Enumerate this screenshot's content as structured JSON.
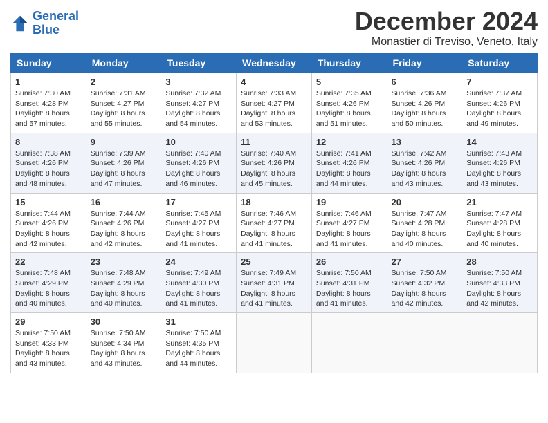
{
  "header": {
    "logo_line1": "General",
    "logo_line2": "Blue",
    "month": "December 2024",
    "location": "Monastier di Treviso, Veneto, Italy"
  },
  "weekdays": [
    "Sunday",
    "Monday",
    "Tuesday",
    "Wednesday",
    "Thursday",
    "Friday",
    "Saturday"
  ],
  "weeks": [
    [
      {
        "day": "1",
        "info": "Sunrise: 7:30 AM\nSunset: 4:28 PM\nDaylight: 8 hours\nand 57 minutes."
      },
      {
        "day": "2",
        "info": "Sunrise: 7:31 AM\nSunset: 4:27 PM\nDaylight: 8 hours\nand 55 minutes."
      },
      {
        "day": "3",
        "info": "Sunrise: 7:32 AM\nSunset: 4:27 PM\nDaylight: 8 hours\nand 54 minutes."
      },
      {
        "day": "4",
        "info": "Sunrise: 7:33 AM\nSunset: 4:27 PM\nDaylight: 8 hours\nand 53 minutes."
      },
      {
        "day": "5",
        "info": "Sunrise: 7:35 AM\nSunset: 4:26 PM\nDaylight: 8 hours\nand 51 minutes."
      },
      {
        "day": "6",
        "info": "Sunrise: 7:36 AM\nSunset: 4:26 PM\nDaylight: 8 hours\nand 50 minutes."
      },
      {
        "day": "7",
        "info": "Sunrise: 7:37 AM\nSunset: 4:26 PM\nDaylight: 8 hours\nand 49 minutes."
      }
    ],
    [
      {
        "day": "8",
        "info": "Sunrise: 7:38 AM\nSunset: 4:26 PM\nDaylight: 8 hours\nand 48 minutes."
      },
      {
        "day": "9",
        "info": "Sunrise: 7:39 AM\nSunset: 4:26 PM\nDaylight: 8 hours\nand 47 minutes."
      },
      {
        "day": "10",
        "info": "Sunrise: 7:40 AM\nSunset: 4:26 PM\nDaylight: 8 hours\nand 46 minutes."
      },
      {
        "day": "11",
        "info": "Sunrise: 7:40 AM\nSunset: 4:26 PM\nDaylight: 8 hours\nand 45 minutes."
      },
      {
        "day": "12",
        "info": "Sunrise: 7:41 AM\nSunset: 4:26 PM\nDaylight: 8 hours\nand 44 minutes."
      },
      {
        "day": "13",
        "info": "Sunrise: 7:42 AM\nSunset: 4:26 PM\nDaylight: 8 hours\nand 43 minutes."
      },
      {
        "day": "14",
        "info": "Sunrise: 7:43 AM\nSunset: 4:26 PM\nDaylight: 8 hours\nand 43 minutes."
      }
    ],
    [
      {
        "day": "15",
        "info": "Sunrise: 7:44 AM\nSunset: 4:26 PM\nDaylight: 8 hours\nand 42 minutes."
      },
      {
        "day": "16",
        "info": "Sunrise: 7:44 AM\nSunset: 4:26 PM\nDaylight: 8 hours\nand 42 minutes."
      },
      {
        "day": "17",
        "info": "Sunrise: 7:45 AM\nSunset: 4:27 PM\nDaylight: 8 hours\nand 41 minutes."
      },
      {
        "day": "18",
        "info": "Sunrise: 7:46 AM\nSunset: 4:27 PM\nDaylight: 8 hours\nand 41 minutes."
      },
      {
        "day": "19",
        "info": "Sunrise: 7:46 AM\nSunset: 4:27 PM\nDaylight: 8 hours\nand 41 minutes."
      },
      {
        "day": "20",
        "info": "Sunrise: 7:47 AM\nSunset: 4:28 PM\nDaylight: 8 hours\nand 40 minutes."
      },
      {
        "day": "21",
        "info": "Sunrise: 7:47 AM\nSunset: 4:28 PM\nDaylight: 8 hours\nand 40 minutes."
      }
    ],
    [
      {
        "day": "22",
        "info": "Sunrise: 7:48 AM\nSunset: 4:29 PM\nDaylight: 8 hours\nand 40 minutes."
      },
      {
        "day": "23",
        "info": "Sunrise: 7:48 AM\nSunset: 4:29 PM\nDaylight: 8 hours\nand 40 minutes."
      },
      {
        "day": "24",
        "info": "Sunrise: 7:49 AM\nSunset: 4:30 PM\nDaylight: 8 hours\nand 41 minutes."
      },
      {
        "day": "25",
        "info": "Sunrise: 7:49 AM\nSunset: 4:31 PM\nDaylight: 8 hours\nand 41 minutes."
      },
      {
        "day": "26",
        "info": "Sunrise: 7:50 AM\nSunset: 4:31 PM\nDaylight: 8 hours\nand 41 minutes."
      },
      {
        "day": "27",
        "info": "Sunrise: 7:50 AM\nSunset: 4:32 PM\nDaylight: 8 hours\nand 42 minutes."
      },
      {
        "day": "28",
        "info": "Sunrise: 7:50 AM\nSunset: 4:33 PM\nDaylight: 8 hours\nand 42 minutes."
      }
    ],
    [
      {
        "day": "29",
        "info": "Sunrise: 7:50 AM\nSunset: 4:33 PM\nDaylight: 8 hours\nand 43 minutes."
      },
      {
        "day": "30",
        "info": "Sunrise: 7:50 AM\nSunset: 4:34 PM\nDaylight: 8 hours\nand 43 minutes."
      },
      {
        "day": "31",
        "info": "Sunrise: 7:50 AM\nSunset: 4:35 PM\nDaylight: 8 hours\nand 44 minutes."
      },
      {
        "day": "",
        "info": ""
      },
      {
        "day": "",
        "info": ""
      },
      {
        "day": "",
        "info": ""
      },
      {
        "day": "",
        "info": ""
      }
    ]
  ]
}
